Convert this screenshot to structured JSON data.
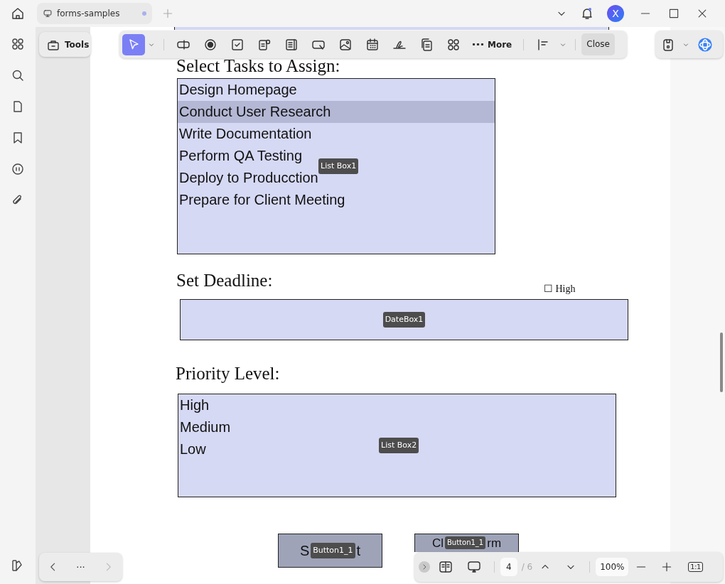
{
  "tab": {
    "title": "forms-samples",
    "unsaved": true
  },
  "avatar": {
    "initial": "X"
  },
  "toolbar": {
    "tools_label": "Tools",
    "more_label": "More",
    "close_label": "Close",
    "select_tool_selected": true
  },
  "document": {
    "task_heading": "Select Tasks to Assign:",
    "task_list": {
      "tag": "List Box1",
      "items": [
        {
          "label": "Design Homepage",
          "selected": false
        },
        {
          "label": "Conduct User Research",
          "selected": true
        },
        {
          "label": "Write Documentation",
          "selected": false
        },
        {
          "label": "Perform QA Testing",
          "selected": false
        },
        {
          "label": "Deploy to Producction",
          "selected": false
        },
        {
          "label": "Prepare for Client Meeting",
          "selected": false
        }
      ]
    },
    "deadline_heading": "Set Deadline:",
    "high_checkbox": "☐ High",
    "date_box": {
      "tag": "DateBox1"
    },
    "priority_heading": "Priority Level:",
    "priority_list": {
      "tag": "List Box2",
      "items": [
        {
          "label": "High",
          "selected": false
        },
        {
          "label": "Medium",
          "selected": false
        },
        {
          "label": "Low",
          "selected": false
        }
      ]
    },
    "buttons": [
      {
        "label_start": "S",
        "tag": "Button1_1",
        "label_end": "t"
      },
      {
        "label_start": "Cl",
        "tag": "Button1_1",
        "label_end": "rm"
      }
    ]
  },
  "page_nav": {
    "more": "···",
    "page": "4",
    "total": "/ 6",
    "zoom": "100%",
    "actual_size": "1:1"
  }
}
